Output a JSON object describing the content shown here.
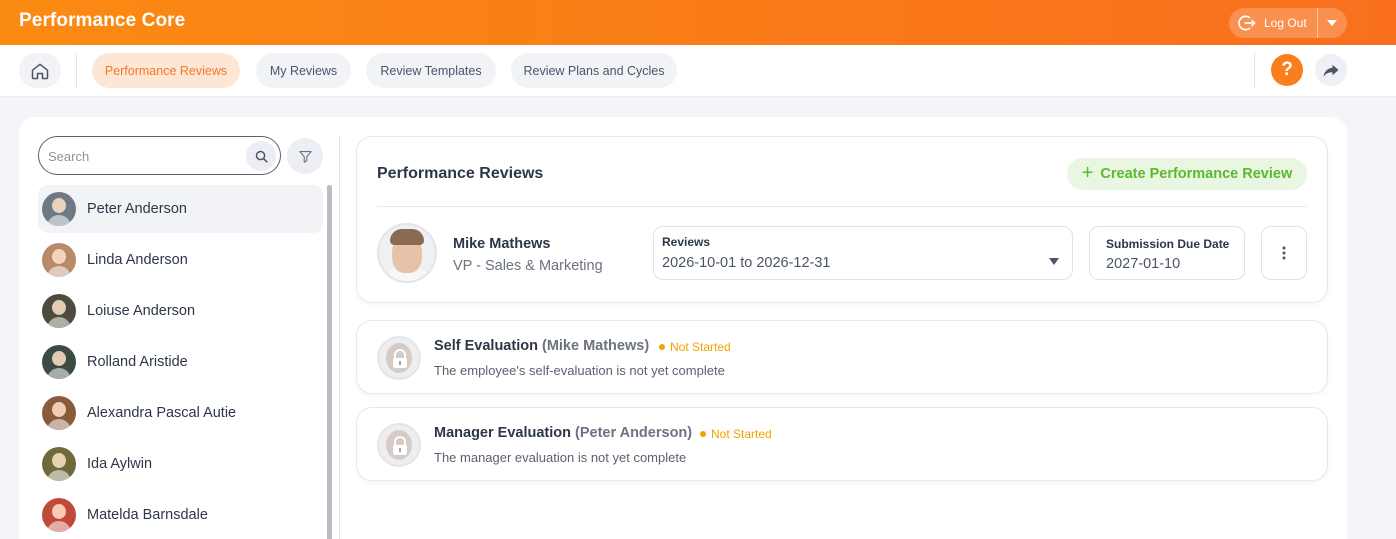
{
  "header": {
    "app_title": "Performance Core",
    "logout_label": "Log Out"
  },
  "nav": {
    "tabs": [
      {
        "label": "Performance Reviews",
        "active": true
      },
      {
        "label": "My Reviews",
        "active": false
      },
      {
        "label": "Review Templates",
        "active": false
      },
      {
        "label": "Review Plans and Cycles",
        "active": false
      }
    ],
    "help_label": "?"
  },
  "sidebar": {
    "search_placeholder": "Search",
    "employees": [
      {
        "name": "Peter Anderson",
        "selected": true
      },
      {
        "name": "Linda Anderson",
        "selected": false
      },
      {
        "name": "Loiuse Anderson",
        "selected": false
      },
      {
        "name": "Rolland Aristide",
        "selected": false
      },
      {
        "name": "Alexandra Pascal Autie",
        "selected": false
      },
      {
        "name": "Ida Aylwin",
        "selected": false
      },
      {
        "name": "Matelda Barnsdale",
        "selected": false
      }
    ]
  },
  "review": {
    "title": "Performance Reviews",
    "create_label": "Create Performance Review",
    "employee_name": "Mike Mathews",
    "employee_role": "VP - Sales & Marketing",
    "reviews_label": "Reviews",
    "reviews_value": "2026-10-01 to 2026-12-31",
    "due_label": "Submission Due Date",
    "due_value": "2027-01-10"
  },
  "evaluations": [
    {
      "title": "Self Evaluation",
      "who": "(Mike Mathews)",
      "status": "Not Started",
      "description": "The employee's self-evaluation is not yet complete"
    },
    {
      "title": "Manager Evaluation",
      "who": "(Peter Anderson)",
      "status": "Not Started",
      "description": "The manager evaluation is not yet complete"
    }
  ],
  "colors": {
    "brand_orange": "#f97f1c",
    "create_green": "#5cb82f",
    "status_amber": "#f2a100"
  }
}
